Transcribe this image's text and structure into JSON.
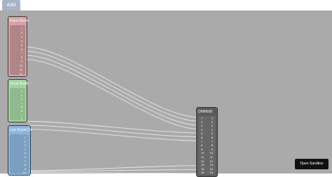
{
  "toolbar": {
    "add_label": "Add"
  },
  "blocks": [
    {
      "id": "piano",
      "title": "Piano Room",
      "ports": [
        "1",
        "2",
        "3",
        "4",
        "5",
        "6",
        "7",
        "8",
        "9",
        "10",
        "11",
        "12"
      ]
    },
    {
      "id": "vocal",
      "title": "Vocal Booth",
      "ports": [
        "1",
        "2",
        "3",
        "4",
        "5",
        "6",
        "7",
        "8"
      ]
    },
    {
      "id": "live",
      "title": "Live Room Cx",
      "ports": [
        "1",
        "2",
        "3",
        "4",
        "5",
        "6",
        "7",
        "8",
        "9",
        "10",
        "11",
        "12",
        "13",
        "14",
        "15",
        "16",
        "17"
      ]
    }
  ],
  "mixer": {
    "title": "DMM600",
    "inputs": [
      "1",
      "2",
      "3",
      "4",
      "5",
      "6",
      "7",
      "8",
      "9",
      "10",
      "11",
      "12",
      "13",
      "14",
      "15"
    ],
    "outputs": [
      "1",
      "2",
      "3",
      "4",
      "5",
      "6",
      "7",
      "8",
      "9",
      "10",
      "11",
      "12",
      "13",
      "14",
      "15"
    ]
  },
  "sandbox": {
    "label": "Open Sandbox"
  },
  "colors": {
    "canvas": "#aaaaaa",
    "piano": "#d8a3a6",
    "vocal": "#a4d3a2",
    "live": "#8eb5dc",
    "mixer": "#5b5b5b",
    "wire": "#e8e8e8",
    "add_button": "#a7b4c6",
    "sandbox_button": "#111111"
  }
}
